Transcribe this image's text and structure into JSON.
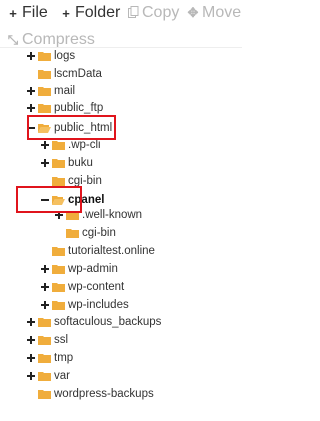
{
  "toolbar": {
    "file_label": "File",
    "folder_label": "Folder",
    "copy_label": "Copy",
    "move_label": "Move",
    "compress_label": "Compress"
  },
  "tree": {
    "logs": "logs",
    "lscmdata": "lscmData",
    "mail": "mail",
    "public_ftp": "public_ftp",
    "public_html": "public_html",
    "wp_cli": ".wp-cli",
    "buku": "buku",
    "cgi_bin": "cgi-bin",
    "cpanel": "cpanel",
    "well_known": ".well-known",
    "cpanel_cgi_bin": "cgi-bin",
    "tutorialtest": "tutorialtest.online",
    "wp_admin": "wp-admin",
    "wp_content": "wp-content",
    "wp_includes": "wp-includes",
    "softaculous_backups": "softaculous_backups",
    "ssl": "ssl",
    "tmp": "tmp",
    "var": "var",
    "wordpress_backups": "wordpress-backups"
  },
  "colors": {
    "folder": "#f0ad3c",
    "highlight": "#e0141c",
    "disabled": "#b8b8b8"
  }
}
